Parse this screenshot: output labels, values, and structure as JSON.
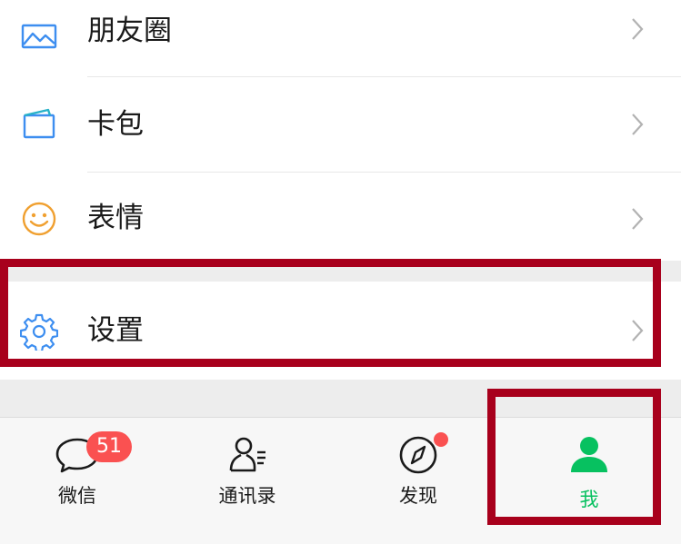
{
  "menu": {
    "moments": {
      "label": "朋友圈",
      "icon": "moments-icon"
    },
    "wallet": {
      "label": "卡包",
      "icon": "wallet-icon"
    },
    "stickers": {
      "label": "表情",
      "icon": "smiley-icon"
    },
    "settings": {
      "label": "设置",
      "icon": "gear-icon"
    }
  },
  "tabbar": {
    "chats": {
      "label": "微信",
      "badge": "51",
      "icon": "chat-bubble-icon"
    },
    "contacts": {
      "label": "通讯录",
      "icon": "contacts-icon"
    },
    "discover": {
      "label": "发现",
      "icon": "compass-icon"
    },
    "me": {
      "label": "我",
      "icon": "person-icon"
    }
  },
  "colors": {
    "accent_green": "#07c160",
    "badge_red": "#fa5151",
    "highlight_red": "#a8001c",
    "icon_blue": "#3d8ef0",
    "icon_orange": "#f0a030",
    "icon_teal": "#27b2c8"
  }
}
